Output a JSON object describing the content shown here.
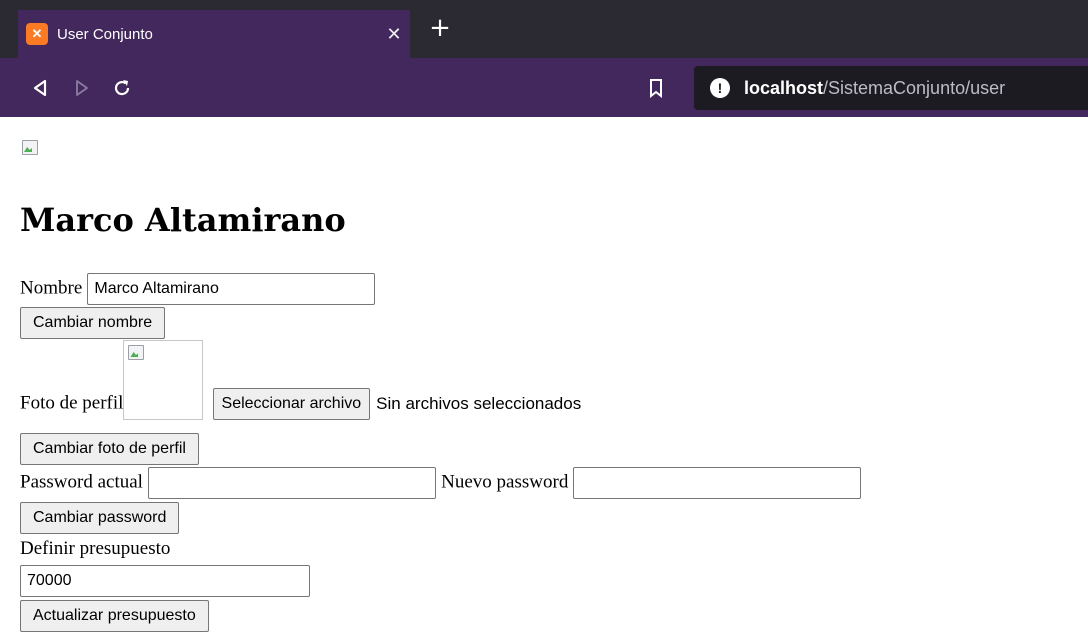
{
  "browser": {
    "tab_title": "User Conjunto",
    "tab_favicon": "xampp-icon",
    "url_host": "localhost",
    "url_path": "/SistemaConjunto/user",
    "colors": {
      "tabbar": "#2b2a33",
      "toolbar": "#42285c",
      "urlbar": "#1c1b22"
    }
  },
  "page": {
    "header_image_alt": "",
    "user_name": "Marco Altamirano",
    "name_form": {
      "label": "Nombre",
      "value": "Marco Altamirano",
      "submit_label": "Cambiar nombre"
    },
    "photo_form": {
      "label": "Foto de perfil",
      "file_button_label": "Seleccionar archivo",
      "file_status": "Sin archivos seleccionados",
      "submit_label": "Cambiar foto de perfil"
    },
    "password_form": {
      "current_label": "Password actual",
      "current_value": "",
      "new_label": "Nuevo password",
      "new_value": "",
      "submit_label": "Cambiar password"
    },
    "budget_form": {
      "label": "Definir presupuesto",
      "value": "70000",
      "submit_label": "Actualizar presupuesto"
    }
  }
}
